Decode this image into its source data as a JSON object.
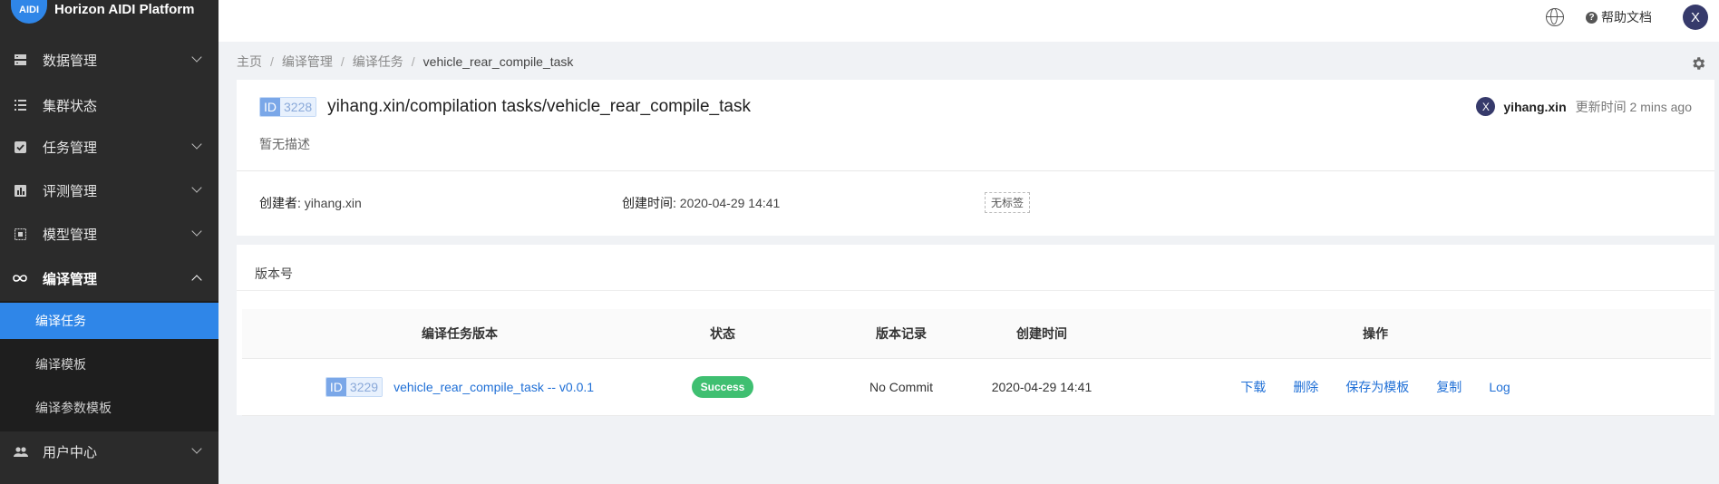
{
  "app": {
    "logo_text": "AIDI",
    "name": "Horizon AIDI Platform"
  },
  "sidebar": {
    "items": [
      {
        "label": "数据管理",
        "icon": "database-icon"
      },
      {
        "label": "集群状态",
        "icon": "list-icon"
      },
      {
        "label": "任务管理",
        "icon": "check-square-icon"
      },
      {
        "label": "评测管理",
        "icon": "bar-chart-icon"
      },
      {
        "label": "模型管理",
        "icon": "model-icon"
      },
      {
        "label": "编译管理",
        "icon": "infinity-icon"
      },
      {
        "label": "用户中心",
        "icon": "users-icon"
      }
    ],
    "sub_items": [
      {
        "label": "编译任务"
      },
      {
        "label": "编译模板"
      },
      {
        "label": "编译参数模板"
      }
    ]
  },
  "topbar": {
    "help_label": "帮助文档",
    "avatar_letter": "X"
  },
  "breadcrumb": [
    "主页",
    "编译管理",
    "编译任务",
    "vehicle_rear_compile_task"
  ],
  "task": {
    "id_key": "ID",
    "id_value": "3228",
    "title": "yihang.xin/compilation tasks/vehicle_rear_compile_task",
    "description": "暂无描述",
    "owner_avatar": "X",
    "owner": "yihang.xin",
    "updated": "更新时间 2 mins ago",
    "creator_label": "创建者:",
    "creator": "yihang.xin",
    "created_label": "创建时间:",
    "created": "2020-04-29 14:41",
    "tags": "无标签"
  },
  "versions": {
    "title": "版本号",
    "columns": [
      "编译任务版本",
      "状态",
      "版本记录",
      "创建时间",
      "操作"
    ],
    "rows": [
      {
        "id_key": "ID",
        "id_value": "3229",
        "name": "vehicle_rear_compile_task -- v0.0.1",
        "status": "Success",
        "record": "No Commit",
        "created": "2020-04-29 14:41",
        "actions": [
          "下载",
          "删除",
          "保存为模板",
          "复制",
          "Log"
        ]
      }
    ]
  },
  "colors": {
    "accent": "#2f86e8",
    "success": "#3fbf71",
    "sidebar_bg": "#2b2b2b",
    "link": "#1f6fd6"
  }
}
